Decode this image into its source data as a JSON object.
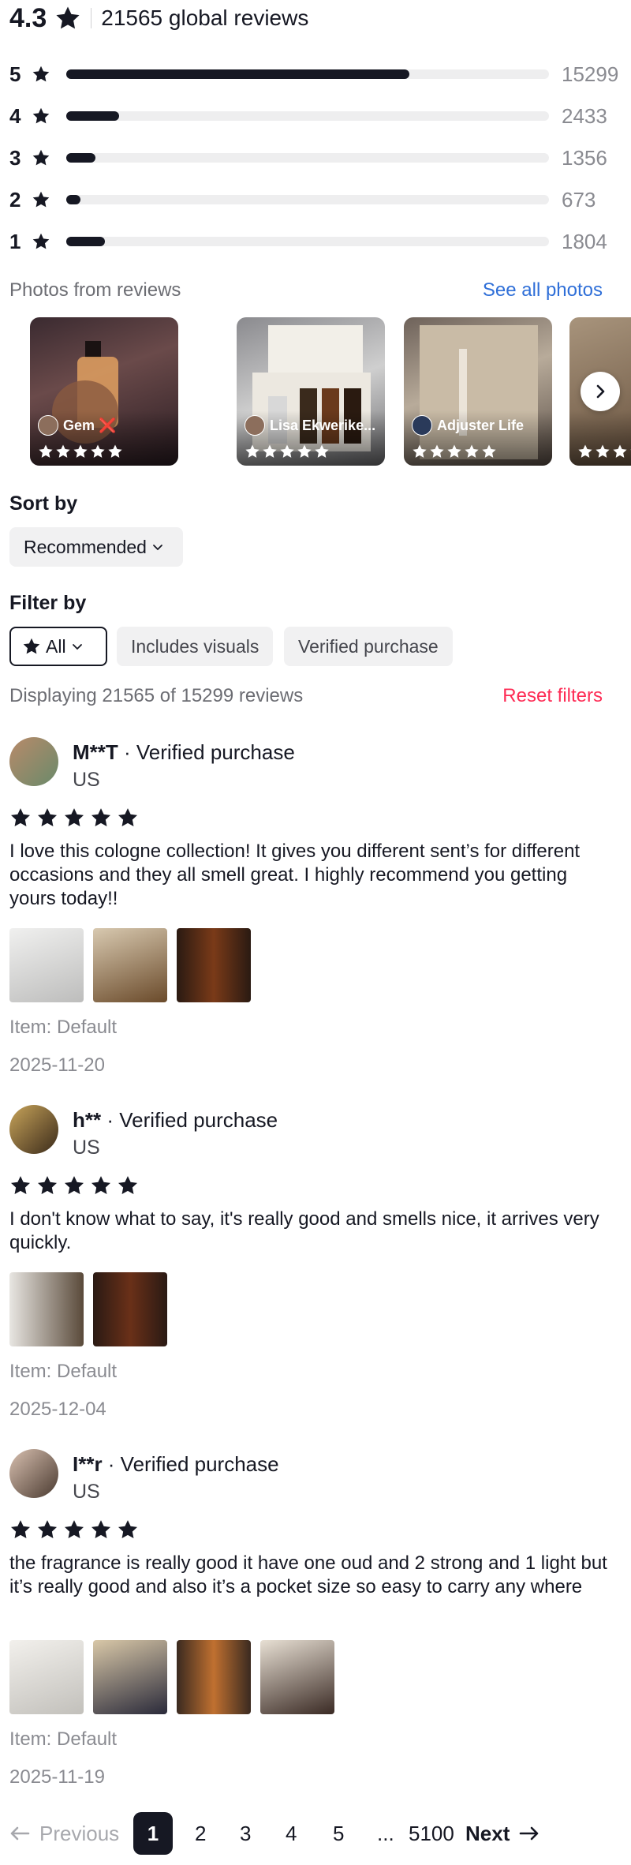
{
  "summary": {
    "average": "4.3",
    "global_reviews": "21565 global reviews"
  },
  "histogram": [
    {
      "stars": "5",
      "count": "15299",
      "fraction": 0.71
    },
    {
      "stars": "4",
      "count": "2433",
      "fraction": 0.11
    },
    {
      "stars": "3",
      "count": "1356",
      "fraction": 0.06
    },
    {
      "stars": "2",
      "count": "673",
      "fraction": 0.03
    },
    {
      "stars": "1",
      "count": "1804",
      "fraction": 0.08
    }
  ],
  "photos": {
    "title": "Photos from reviews",
    "see_all": "See all photos",
    "items": [
      {
        "user": "Gem ❌",
        "rating": 5
      },
      {
        "user": "Lisa Ekwerike...",
        "rating": 5
      },
      {
        "user": "Adjuster Life",
        "rating": 5
      },
      {
        "user": "",
        "rating": 5
      }
    ]
  },
  "sort": {
    "label": "Sort by",
    "value": "Recommended"
  },
  "filter": {
    "label": "Filter by",
    "all": "All",
    "visuals": "Includes visuals",
    "verified": "Verified purchase"
  },
  "displaying": {
    "text": "Displaying 21565 of 15299 reviews",
    "reset": "Reset filters"
  },
  "reviews": [
    {
      "user": "M**T",
      "badge": " · Verified purchase",
      "country": "US",
      "rating": 5,
      "text": "I love this cologne collection! It gives you different sent’s for different occasions and they all smell great. I highly recommend you getting yours today!!",
      "item": "Item: Default",
      "date": "2025-11-20"
    },
    {
      "user": "h**",
      "badge": " · Verified purchase",
      "country": "US",
      "rating": 5,
      "text": "I don't know what to say, it's really good and smells nice, it arrives very quickly.",
      "item": "Item: Default",
      "date": "2025-12-04"
    },
    {
      "user": "I**r",
      "badge": " · Verified purchase",
      "country": "US",
      "rating": 5,
      "text": "the fragrance is really good it have one oud and 2 strong and 1 light but it’s really good and also it’s a pocket size so easy to carry any where",
      "item": "Item: Default",
      "date": "2025-11-19"
    }
  ],
  "pagination": {
    "previous": "Previous",
    "pages": [
      "1",
      "2",
      "3",
      "4",
      "5",
      "...",
      "5100"
    ],
    "current": "1",
    "next": "Next"
  },
  "colors": {
    "text": "#161823",
    "muted": "#8a8b91",
    "link": "#2f6fd8",
    "accent": "#fe2c55",
    "bar": "#161823",
    "track": "#eeeeef"
  },
  "icons": {
    "star": "star-icon",
    "chevron": "chevron-down-icon",
    "next_arrow": "chevron-right-icon",
    "left_arrow": "arrow-left-icon",
    "right_arrow": "arrow-right-icon"
  }
}
